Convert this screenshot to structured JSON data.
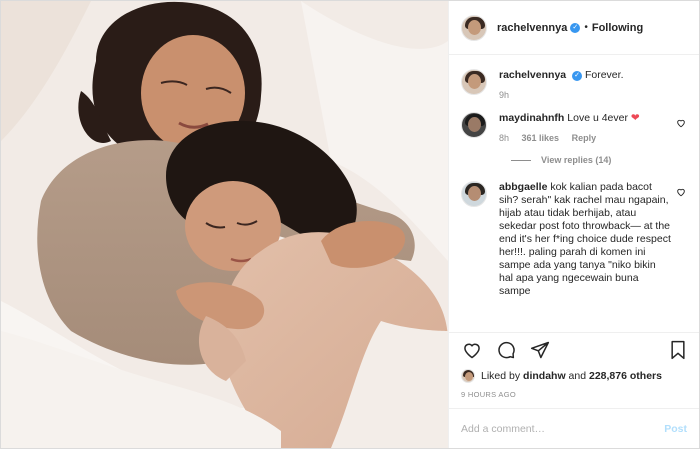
{
  "post": {
    "photo_icon": "photo-of-two-women-embracing",
    "username": "rachelvennya",
    "verified_icon": "verified-badge-icon",
    "separator": "•",
    "follow_state": "Following"
  },
  "caption": {
    "username": "rachelvennya",
    "text": "Forever.",
    "time": "9h"
  },
  "comments": [
    {
      "username": "maydinahnfh",
      "text": "Love u 4ever",
      "emoji": "❤",
      "time": "8h",
      "likes": "361 likes",
      "reply": "Reply",
      "view_replies": "View replies (14)"
    },
    {
      "username": "abbgaelle",
      "text": "kok kalian pada bacot sih? serah\" kak rachel mau ngapain, hijab atau tidak berhijab, atau sekedar post foto throwback— at the end it's her f*ing choice dude respect her!!!. paling parah di komen ini sampe ada yang tanya \"niko bikin hal apa yang ngecewain buna sampe"
    }
  ],
  "actions": {
    "like_icon": "heart-icon",
    "comment_icon": "comment-icon",
    "share_icon": "share-icon",
    "save_icon": "bookmark-icon"
  },
  "likes": {
    "prefix": "Liked by",
    "by_user": "dindahw",
    "middle": "and",
    "others": "228,876 others"
  },
  "timestamp": "9 HOURS AGO",
  "add_comment": {
    "placeholder": "Add a comment…",
    "post_label": "Post"
  },
  "colors": {
    "accent_blue": "#3897f0",
    "post_disabled": "#b2dffc",
    "heart_red": "#ed4956",
    "muted": "#8e8e8e"
  }
}
